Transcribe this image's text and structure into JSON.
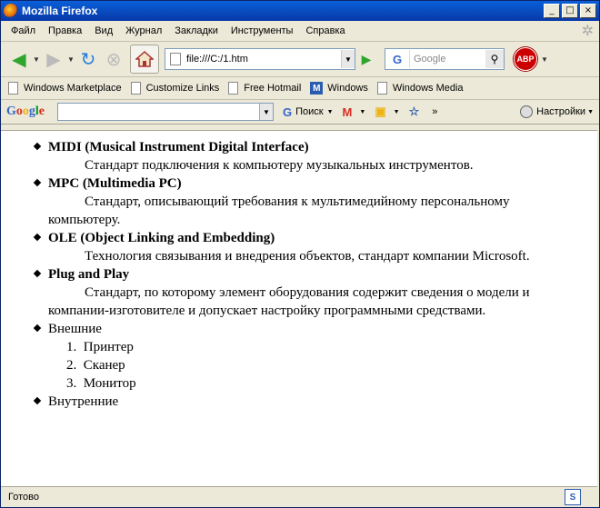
{
  "window": {
    "title": "Mozilla Firefox",
    "min": "_",
    "max": "□",
    "close": "×"
  },
  "menu": [
    "Файл",
    "Правка",
    "Вид",
    "Журнал",
    "Закладки",
    "Инструменты",
    "Справка"
  ],
  "nav": {
    "url": "file:///C:/1.htm",
    "search_placeholder": "Google",
    "abp": "ABP"
  },
  "bookmarks": [
    "Windows Marketplace",
    "Customize Links",
    "Free Hotmail",
    "Windows",
    "Windows Media"
  ],
  "google_toolbar": {
    "logo": "Google",
    "search_label": "Поиск",
    "more": "»",
    "settings": "Настройки"
  },
  "content": {
    "terms": [
      {
        "term": "MIDI (Musical Instrument Digital Interface)",
        "def": "Стандарт подключения к компьютеру музыкальных инструментов."
      },
      {
        "term": "MPC (Multimedia PC)",
        "def": "Стандарт, описывающий требования к мультимедийному персональному компьютеру."
      },
      {
        "term": "OLE (Object Linking and Embedding)",
        "def": "Технология связывания и внедрения объектов, стандарт компании Microsoft."
      },
      {
        "term": "Plug and Play",
        "def": "Стандарт, по которому элемент оборудования содержит сведения о модели и компании-изготовителе и допускает настройку программными средствами."
      }
    ],
    "external": "Внешние",
    "external_items": [
      "Принтер",
      "Сканер",
      "Монитор"
    ],
    "internal": "Внутренние"
  },
  "status": {
    "text": "Готово"
  }
}
